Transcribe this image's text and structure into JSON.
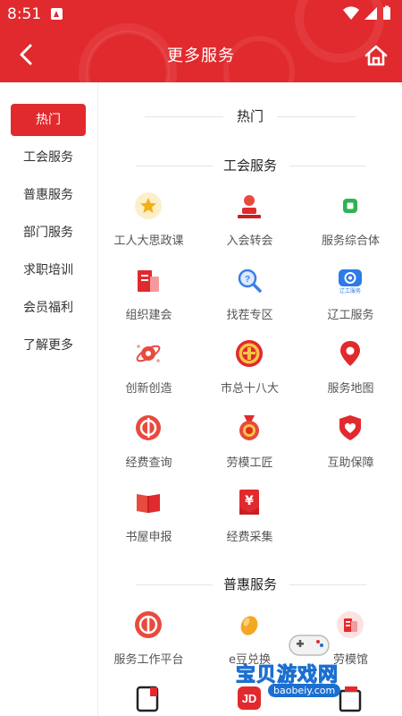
{
  "status_bar": {
    "time": "8:51"
  },
  "header": {
    "title": "更多服务"
  },
  "sidebar": {
    "items": [
      {
        "label": "热门",
        "active": true
      },
      {
        "label": "工会服务"
      },
      {
        "label": "普惠服务"
      },
      {
        "label": "部门服务"
      },
      {
        "label": "求职培训"
      },
      {
        "label": "会员福利"
      },
      {
        "label": "了解更多"
      }
    ]
  },
  "sections": {
    "hot": {
      "title": "热门"
    },
    "union": {
      "title": "工会服务",
      "items": [
        {
          "label": "工人大思政课",
          "icon": "star-badge-icon"
        },
        {
          "label": "入会转会",
          "icon": "member-transfer-icon"
        },
        {
          "label": "服务综合体",
          "icon": "service-complex-icon"
        },
        {
          "label": "组织建会",
          "icon": "organization-icon"
        },
        {
          "label": "找茬专区",
          "icon": "magnifier-icon"
        },
        {
          "label": "辽工服务",
          "icon": "liaogong-service-icon",
          "icon_caption": "辽工服务"
        },
        {
          "label": "创新创造",
          "icon": "innovation-icon"
        },
        {
          "label": "市总十八大",
          "icon": "union-emblem-icon"
        },
        {
          "label": "服务地图",
          "icon": "map-pin-icon"
        },
        {
          "label": "经费查询",
          "icon": "funds-query-icon"
        },
        {
          "label": "劳模工匠",
          "icon": "medal-icon"
        },
        {
          "label": "互助保障",
          "icon": "shield-heart-icon"
        },
        {
          "label": "书屋申报",
          "icon": "book-icon"
        },
        {
          "label": "经费采集",
          "icon": "yuan-collect-icon",
          "icon_caption": "¥"
        }
      ]
    },
    "benefit": {
      "title": "普惠服务",
      "items": [
        {
          "label": "服务工作平台",
          "icon": "union-emblem-circle-icon"
        },
        {
          "label": "e豆兑换",
          "icon": "bean-icon"
        },
        {
          "label": "劳模馆",
          "icon": "model-hall-icon"
        }
      ],
      "more_icons": [
        "wallet-icon",
        "jd-icon",
        "card-icon"
      ],
      "jd_caption": "JD"
    }
  },
  "watermark": {
    "text": "宝贝游戏网",
    "url": "baobeiy.com"
  },
  "colors": {
    "brand_red": "#e12a2e",
    "text_dark": "#222222",
    "text_gray": "#555555"
  }
}
